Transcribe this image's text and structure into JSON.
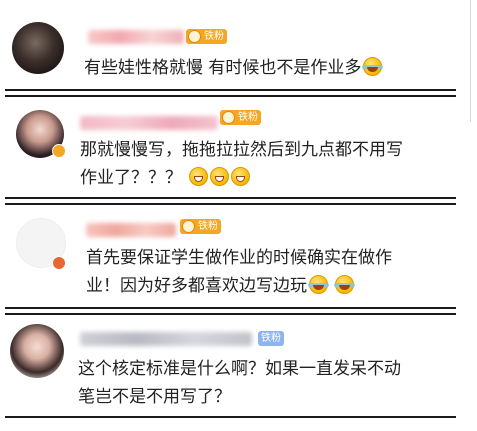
{
  "comments": [
    {
      "badge": "铁粉",
      "badge_color": "#f5a623",
      "text_lines": [
        "有些娃性格就慢 有时候也不是作业多"
      ],
      "emojis": [
        "laugh-cry-emoji"
      ]
    },
    {
      "badge": "铁粉",
      "badge_color": "#f5a623",
      "text_lines": [
        "那就慢慢写，拖拖拉拉然后到九点都不用写",
        "作业了？？？"
      ],
      "emojis": [
        "grin-emoji",
        "grin-emoji",
        "grin-emoji"
      ]
    },
    {
      "badge": "铁粉",
      "badge_color": "#f5a623",
      "text_lines": [
        "首先要保证学生做作业的时候确实在做作",
        "业！因为好多都喜欢边写边玩"
      ],
      "emojis": [
        "laugh-cry-emoji",
        "laugh-cry-emoji"
      ]
    },
    {
      "badge": "铁粉",
      "badge_color": "#8db4ee",
      "text_lines": [
        "这个核定标准是什么啊？如果一直发呆不动",
        "笔岂不是不用写了？"
      ],
      "emojis": []
    }
  ]
}
